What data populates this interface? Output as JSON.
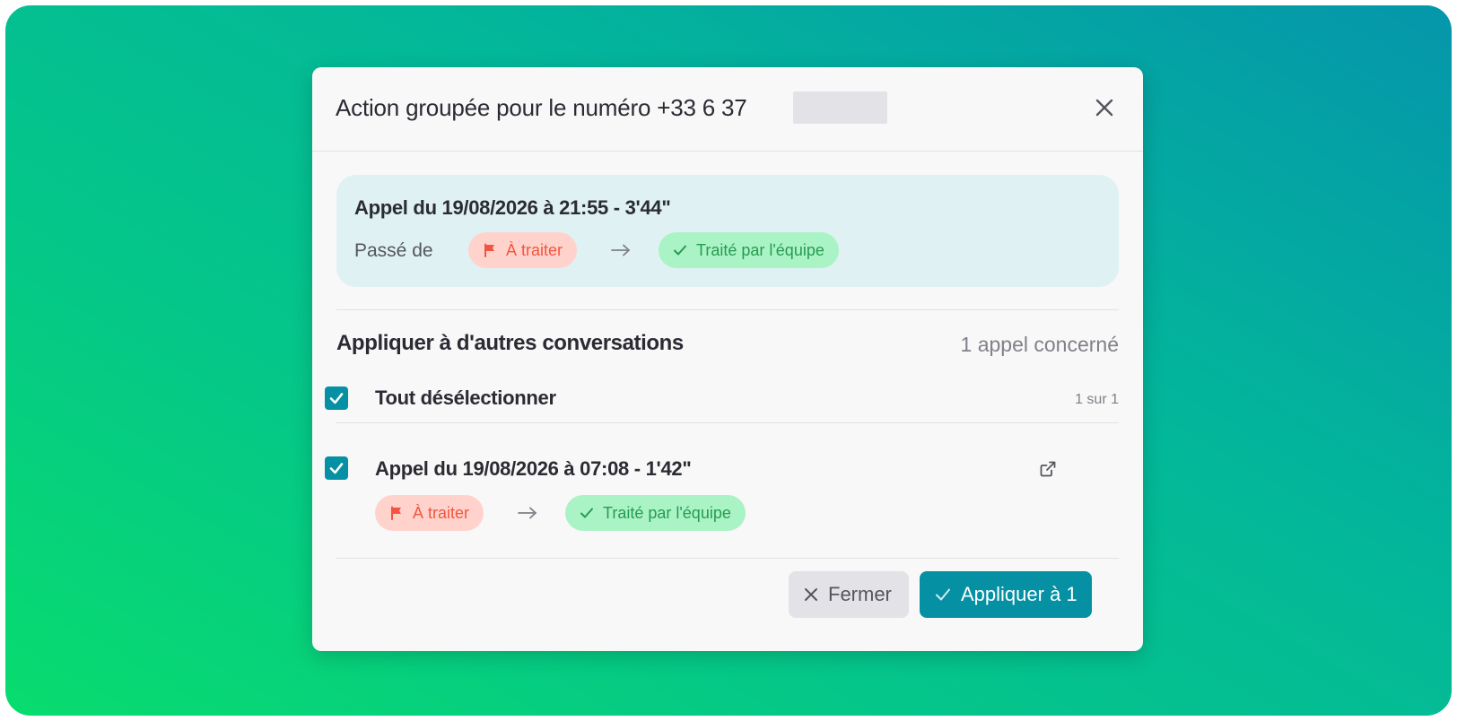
{
  "modal": {
    "title": "Action groupée pour le numéro +33 6 37",
    "close_icon": "close-icon"
  },
  "summary": {
    "title": "Appel du 19/08/2026 à 21:55 - 3'44\"",
    "passed_label": "Passé de",
    "from_status": "À traiter",
    "to_status": "Traité par l'équipe"
  },
  "apply": {
    "section_title": "Appliquer à d'autres conversations",
    "count_label": "1 appel concerné",
    "select_all_label": "Tout désélectionner",
    "select_all_count": "1 sur 1",
    "items": [
      {
        "title": "Appel du 19/08/2026 à 07:08 - 1'42\"",
        "from_status": "À traiter",
        "to_status": "Traité par l'équipe",
        "checked": true
      }
    ]
  },
  "footer": {
    "close_label": "Fermer",
    "apply_label": "Appliquer à 1"
  },
  "colors": {
    "accent": "#0590a4",
    "status_red_bg": "#ffd3cc",
    "status_red_text": "#f2553f",
    "status_green_bg": "#aaf3c5",
    "status_green_text": "#279b52"
  }
}
